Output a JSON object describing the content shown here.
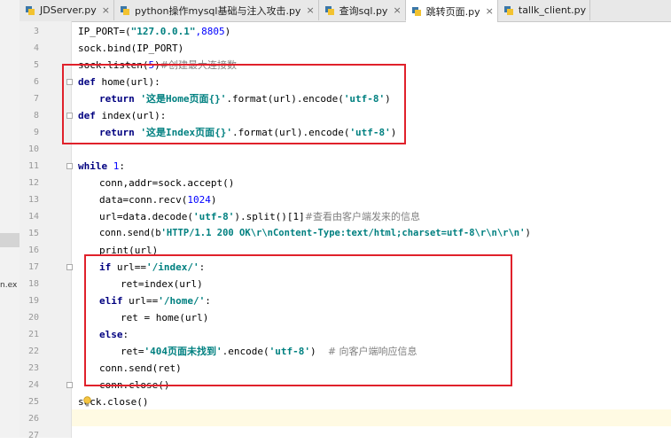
{
  "tabs": [
    {
      "label": "JDServer.py",
      "active": false
    },
    {
      "label": "python操作mysql基础与注入攻击.py",
      "active": false
    },
    {
      "label": "查询sql.py",
      "active": false
    },
    {
      "label": "跳转页面.py",
      "active": true
    },
    {
      "label": "tallk_client.py",
      "active": false
    }
  ],
  "sidebar_fragment": "n.ex",
  "line_numbers": [
    "3",
    "4",
    "5",
    "6",
    "7",
    "8",
    "9",
    "10",
    "11",
    "12",
    "13",
    "14",
    "15",
    "16",
    "17",
    "18",
    "19",
    "20",
    "21",
    "22",
    "23",
    "24",
    "25",
    "26",
    "27"
  ],
  "code": {
    "l3_a": "IP_PORT=(",
    "l3_str": "\"127.0.0.1\"",
    "l3_num": ",8805",
    "l3_b": ")",
    "l4": "sock.bind(IP_PORT)",
    "l5_a": "sock.listen(",
    "l5_num": "5",
    "l5_b": ")",
    "l5_cmt": "#创建最大连接数",
    "l6_kw": "def",
    "l6_rest": " home(url):",
    "l7_kw": "return",
    "l7_str": "'这是Home页面{}'",
    "l7_a": ".format(url).encode(",
    "l7_str2": "'utf-8'",
    "l7_b": ")",
    "l8_kw": "def",
    "l8_rest": " index(url):",
    "l9_kw": "return",
    "l9_str": "'这是Index页面{}'",
    "l9_a": ".format(url).encode(",
    "l9_str2": "'utf-8'",
    "l9_b": ")",
    "l11_kw": "while",
    "l11_num": "1",
    "l11_b": ":",
    "l12": "conn,addr=sock.accept()",
    "l13_a": "data=conn.recv(",
    "l13_num": "1024",
    "l13_b": ")",
    "l14_a": "url=data.decode(",
    "l14_str": "'utf-8'",
    "l14_b": ").split()[1]",
    "l14_cmt": "#查看由客户端发来的信息",
    "l15_a": "conn.send(b",
    "l15_str": "'HTTP/1.1 200 OK\\r\\nContent-Type:text/html;charset=utf-8\\r\\n\\r\\n'",
    "l15_b": ")",
    "l16": "print(url)",
    "l17_kw": "if",
    "l17_a": " url==",
    "l17_str": "'/index/'",
    "l17_b": ":",
    "l18": "ret=index(url)",
    "l19_kw": "elif",
    "l19_a": " url==",
    "l19_str": "'/home/'",
    "l19_b": ":",
    "l20": "ret = home(url)",
    "l21_kw": "else",
    "l21_b": ":",
    "l22_a": "ret=",
    "l22_str": "'404页面未找到'",
    "l22_b": ".encode(",
    "l22_str2": "'utf-8'",
    "l22_c": ")",
    "l22_cmt": "# 向客户端响应信息",
    "l23": "conn.send(ret)",
    "l24": "conn.close()",
    "l25": "sock.close()"
  },
  "colors": {
    "keyword": "#000080",
    "string": "#008080",
    "number": "#0000ff",
    "comment": "#808080",
    "highlight_box": "#e0212b"
  }
}
